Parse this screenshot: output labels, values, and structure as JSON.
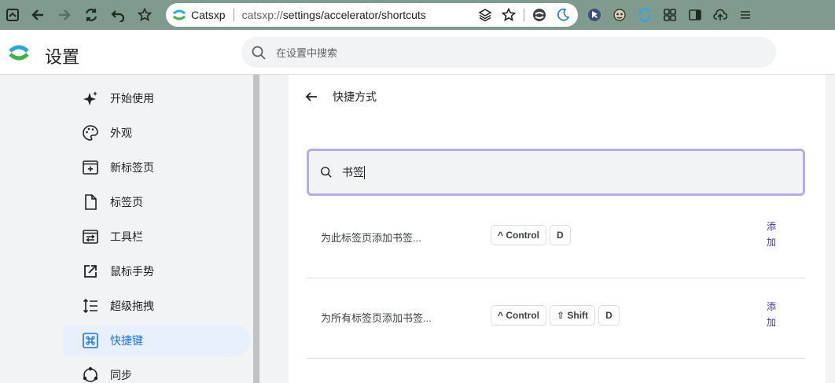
{
  "browser": {
    "site_name": "Catsxp",
    "url_prefix": "catsxp://",
    "url_path": "settings/accelerator/shortcuts"
  },
  "header": {
    "title": "设置",
    "search_placeholder": "在设置中搜索"
  },
  "sidebar": {
    "items": [
      {
        "label": "开始使用",
        "icon": "sparkle-icon"
      },
      {
        "label": "外观",
        "icon": "palette-icon"
      },
      {
        "label": "新标签页",
        "icon": "new-tab-icon"
      },
      {
        "label": "标签页",
        "icon": "page-icon"
      },
      {
        "label": "工具栏",
        "icon": "toolbar-icon"
      },
      {
        "label": "鼠标手势",
        "icon": "open-external-icon"
      },
      {
        "label": "超级拖拽",
        "icon": "reorder-icon"
      },
      {
        "label": "快捷键",
        "icon": "command-icon",
        "active": true
      },
      {
        "label": "同步",
        "icon": "sync-icon"
      }
    ]
  },
  "main": {
    "title": "快捷方式",
    "filter_value": "书签",
    "shortcuts": [
      {
        "label": "为此标签页添加书签...",
        "keys": [
          "^ Control",
          "D"
        ],
        "add_label": "添加"
      },
      {
        "label": "为所有标签页添加书签...",
        "keys": [
          "^ Control",
          "⇧ Shift",
          "D"
        ],
        "add_label": "添加"
      }
    ]
  },
  "colors": {
    "toolbar": "#809b8d",
    "accent": "#1a73e8",
    "filter_focus": "#b5aaf2",
    "add_link": "#3c33b5"
  }
}
